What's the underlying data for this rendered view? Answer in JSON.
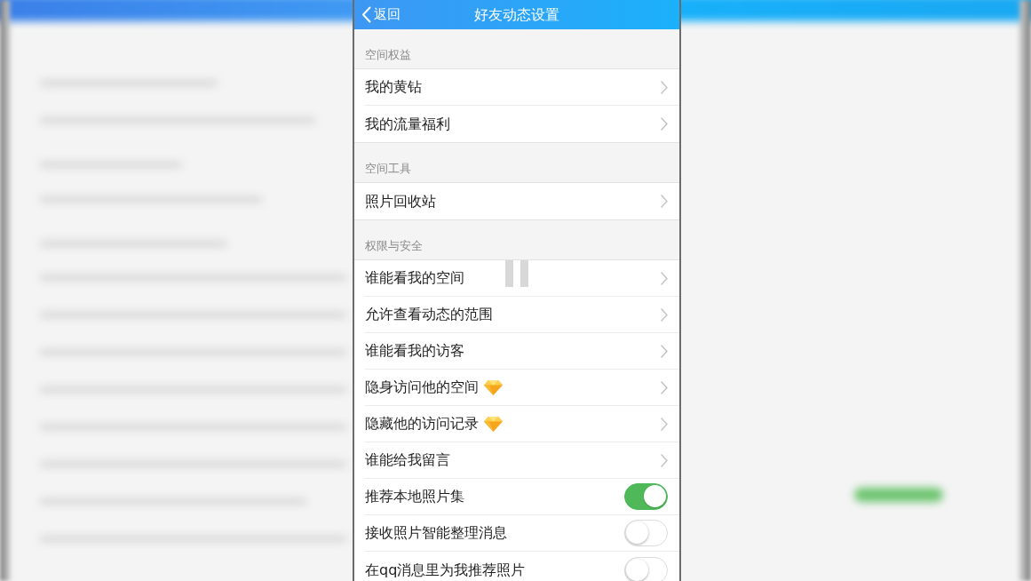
{
  "nav_bar": {
    "back": "返回",
    "title": "好友动态设置"
  },
  "sections": [
    {
      "title": "空间权益",
      "items": [
        {
          "kind": "link",
          "label": "我的黄钻",
          "premium": false
        },
        {
          "kind": "link",
          "label": "我的流量福利",
          "premium": false
        }
      ]
    },
    {
      "title": "空间工具",
      "items": [
        {
          "kind": "link",
          "label": "照片回收站",
          "premium": false
        }
      ]
    },
    {
      "title": "权限与安全",
      "items": [
        {
          "kind": "link",
          "label": "谁能看我的空间",
          "premium": false
        },
        {
          "kind": "link",
          "label": "允许查看动态的范围",
          "premium": false
        },
        {
          "kind": "link",
          "label": "谁能看我的访客",
          "premium": false
        },
        {
          "kind": "link",
          "label": "隐身访问他的空间",
          "premium": true
        },
        {
          "kind": "link",
          "label": "隐藏他的访问记录",
          "premium": true
        },
        {
          "kind": "link",
          "label": "谁能给我留言",
          "premium": false
        },
        {
          "kind": "toggle",
          "label": "推荐本地照片集",
          "on": true
        },
        {
          "kind": "toggle",
          "label": "接收照片智能整理消息",
          "on": false
        },
        {
          "kind": "toggle",
          "label": "在qq消息里为我推荐照片",
          "on": false
        }
      ]
    }
  ]
}
